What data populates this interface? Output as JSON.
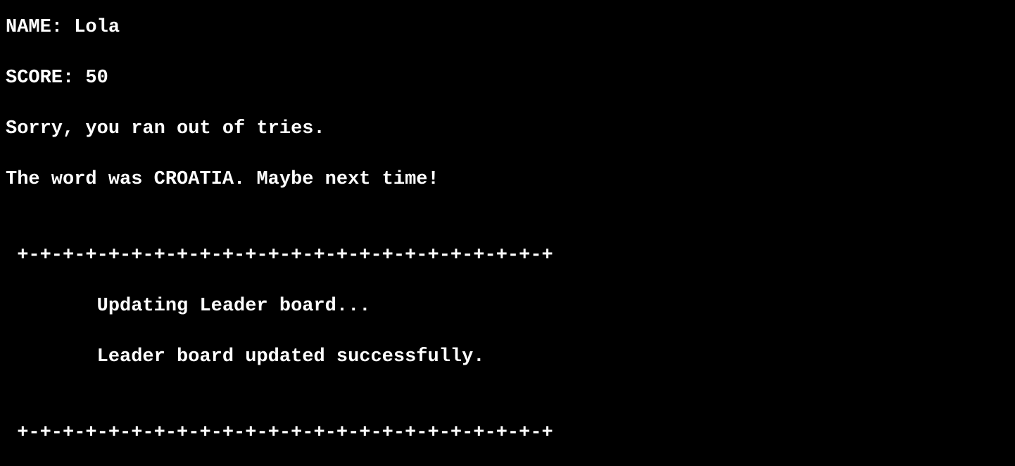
{
  "terminal": {
    "name_line": "NAME: Lola",
    "score_line": "SCORE: 50",
    "message_line": "Sorry, you ran out of tries.",
    "word_line": "The word was CROATIA. Maybe next time!",
    "divider_top": " +-+-+-+-+-+-+-+-+-+-+-+-+-+-+-+-+-+-+-+-+-+-+-+",
    "updating_line": "        Updating Leader board...",
    "updated_line": "        Leader board updated successfully.",
    "divider_bottom": " +-+-+-+-+-+-+-+-+-+-+-+-+-+-+-+-+-+-+-+-+-+-+-+"
  },
  "colors": {
    "background": "#000000",
    "foreground": "#ffffff"
  }
}
